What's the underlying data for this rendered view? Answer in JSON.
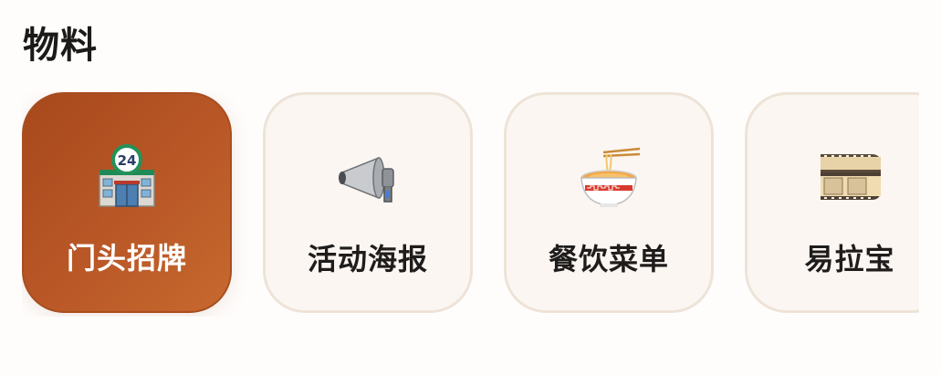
{
  "section": {
    "title": "物料"
  },
  "items": [
    {
      "label": "门头招牌",
      "icon": "convenience-store-icon",
      "selected": true
    },
    {
      "label": "活动海报",
      "icon": "megaphone-icon",
      "selected": false
    },
    {
      "label": "餐饮菜单",
      "icon": "noodle-bowl-icon",
      "selected": false
    },
    {
      "label": "易拉宝",
      "icon": "film-roll-icon",
      "selected": false
    }
  ],
  "store_sign_text": "24",
  "colors": {
    "active_card": "#b85626",
    "card_background": "#fbf6f1",
    "card_border": "#eee3d8"
  }
}
